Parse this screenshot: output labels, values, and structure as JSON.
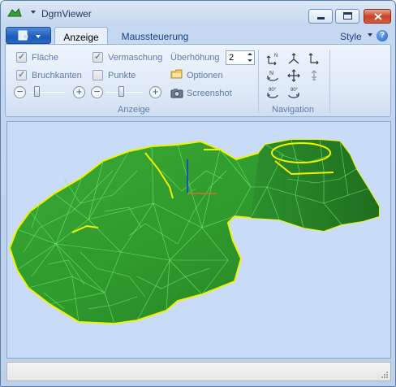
{
  "window": {
    "title": "DgmViewer"
  },
  "tabs": [
    {
      "label": "Anzeige",
      "active": true
    },
    {
      "label": "Maussteuerung",
      "active": false
    }
  ],
  "ribbon_right": {
    "style_label": "Style",
    "help_glyph": "?"
  },
  "anzeige_group": {
    "title": "Anzeige",
    "checkboxes": [
      {
        "label": "Fläche",
        "checked": true
      },
      {
        "label": "Bruchkanten",
        "checked": true
      },
      {
        "label": "Vermaschung",
        "checked": true
      },
      {
        "label": "Punkte",
        "checked": false
      }
    ],
    "ueberhoehung_label": "Überhöhung",
    "ueberhoehung_value": "2",
    "optionen_label": "Optionen",
    "screenshot_label": "Screenshot",
    "slider_minus": "−",
    "slider_plus": "+"
  },
  "navigation_group": {
    "title": "Navigation",
    "icons": [
      "axis-n-icon",
      "axis-iso-icon",
      "axis-e-icon",
      "rotate-n-icon",
      "pan-icon",
      "zoom-up-icon",
      "rotate-90-left-icon",
      "rotate-90-right-icon"
    ],
    "rotate_label": "90°"
  },
  "colors": {
    "terrain_fill": "#2d9a2d",
    "terrain_mesh": "#6cf06c",
    "break_lines": "#f2f200",
    "viewport_bg": "#c8dcfa"
  }
}
